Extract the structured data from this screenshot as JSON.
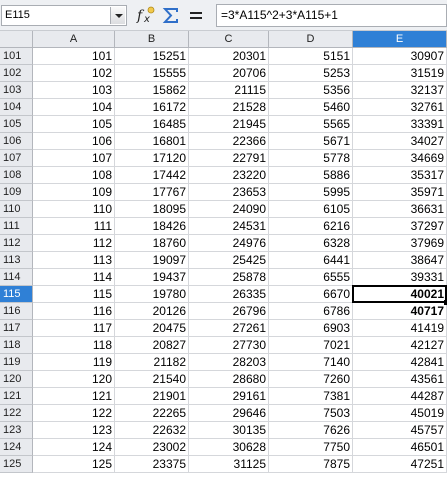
{
  "formula_bar": {
    "name_box": "E115",
    "formula": "=3*A115^2+3*A115+1",
    "icons": [
      "dropdown-arrow-icon",
      "function-wizard-icon",
      "sum-icon",
      "equals-icon"
    ]
  },
  "sheet": {
    "columns": [
      "A",
      "B",
      "C",
      "D",
      "E"
    ],
    "selected_column": "E",
    "selected_row": "115",
    "active_cell": "E115",
    "selection_color": "#2f80d6",
    "rows": [
      {
        "num": "101",
        "cells": [
          "101",
          "15251",
          "20301",
          "5151",
          "30907"
        ]
      },
      {
        "num": "102",
        "cells": [
          "102",
          "15555",
          "20706",
          "5253",
          "31519"
        ]
      },
      {
        "num": "103",
        "cells": [
          "103",
          "15862",
          "21115",
          "5356",
          "32137"
        ]
      },
      {
        "num": "104",
        "cells": [
          "104",
          "16172",
          "21528",
          "5460",
          "32761"
        ]
      },
      {
        "num": "105",
        "cells": [
          "105",
          "16485",
          "21945",
          "5565",
          "33391"
        ]
      },
      {
        "num": "106",
        "cells": [
          "106",
          "16801",
          "22366",
          "5671",
          "34027"
        ]
      },
      {
        "num": "107",
        "cells": [
          "107",
          "17120",
          "22791",
          "5778",
          "34669"
        ]
      },
      {
        "num": "108",
        "cells": [
          "108",
          "17442",
          "23220",
          "5886",
          "35317"
        ]
      },
      {
        "num": "109",
        "cells": [
          "109",
          "17767",
          "23653",
          "5995",
          "35971"
        ]
      },
      {
        "num": "110",
        "cells": [
          "110",
          "18095",
          "24090",
          "6105",
          "36631"
        ]
      },
      {
        "num": "111",
        "cells": [
          "111",
          "18426",
          "24531",
          "6216",
          "37297"
        ]
      },
      {
        "num": "112",
        "cells": [
          "112",
          "18760",
          "24976",
          "6328",
          "37969"
        ]
      },
      {
        "num": "113",
        "cells": [
          "113",
          "19097",
          "25425",
          "6441",
          "38647"
        ]
      },
      {
        "num": "114",
        "cells": [
          "114",
          "19437",
          "25878",
          "6555",
          "39331"
        ]
      },
      {
        "num": "115",
        "cells": [
          "115",
          "19780",
          "26335",
          "6670",
          "40021"
        ]
      },
      {
        "num": "116",
        "cells": [
          "116",
          "20126",
          "26796",
          "6786",
          "40717"
        ]
      },
      {
        "num": "117",
        "cells": [
          "117",
          "20475",
          "27261",
          "6903",
          "41419"
        ]
      },
      {
        "num": "118",
        "cells": [
          "118",
          "20827",
          "27730",
          "7021",
          "42127"
        ]
      },
      {
        "num": "119",
        "cells": [
          "119",
          "21182",
          "28203",
          "7140",
          "42841"
        ]
      },
      {
        "num": "120",
        "cells": [
          "120",
          "21540",
          "28680",
          "7260",
          "43561"
        ]
      },
      {
        "num": "121",
        "cells": [
          "121",
          "21901",
          "29161",
          "7381",
          "44287"
        ]
      },
      {
        "num": "122",
        "cells": [
          "122",
          "22265",
          "29646",
          "7503",
          "45019"
        ]
      },
      {
        "num": "123",
        "cells": [
          "123",
          "22632",
          "30135",
          "7626",
          "45757"
        ]
      },
      {
        "num": "124",
        "cells": [
          "124",
          "23002",
          "30628",
          "7750",
          "46501"
        ]
      },
      {
        "num": "125",
        "cells": [
          "125",
          "23375",
          "31125",
          "7875",
          "47251"
        ]
      }
    ],
    "bold_cells": [
      "E115",
      "E116"
    ]
  }
}
